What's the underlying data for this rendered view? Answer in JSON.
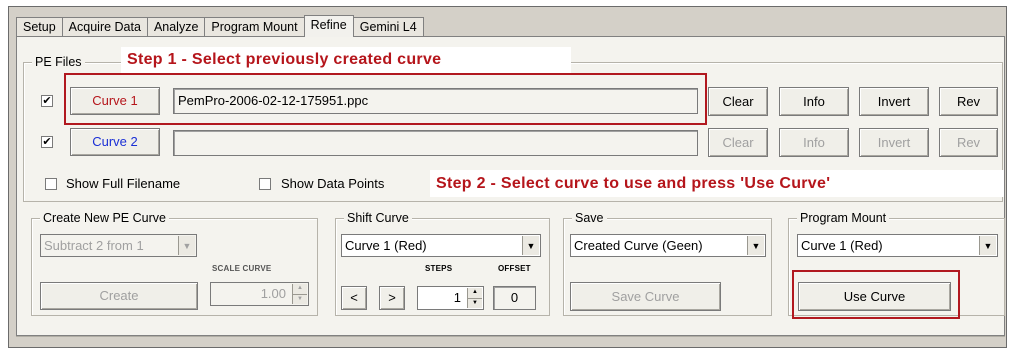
{
  "tabs": [
    "Setup",
    "Acquire Data",
    "Analyze",
    "Program Mount",
    "Refine",
    "Gemini L4"
  ],
  "pe_files": {
    "legend": "PE Files",
    "curve1": {
      "checked": "✔",
      "button": "Curve 1",
      "filename": "PemPro-2006-02-12-175951.ppc"
    },
    "curve2": {
      "checked": "✔",
      "button": "Curve 2",
      "filename": ""
    },
    "clear_label": "Clear",
    "info_label": "Info",
    "invert_label": "Invert",
    "rev_label": "Rev",
    "show_full_filename": "Show Full Filename",
    "show_data_points": "Show Data Points"
  },
  "annotations": {
    "step1": "Step 1 - Select previously created curve",
    "step2": "Step 2 - Select curve to use and press 'Use Curve'"
  },
  "create_new": {
    "legend": "Create New PE Curve",
    "select_value": "Subtract 2 from 1",
    "scale_label": "SCALE CURVE",
    "scale_value": "1.00",
    "create_label": "Create"
  },
  "shift_curve": {
    "legend": "Shift Curve",
    "select_value": "Curve 1 (Red)",
    "steps_label": "STEPS",
    "offset_label": "OFFSET",
    "steps_value": "1",
    "offset_value": "0",
    "left_label": "<",
    "right_label": ">"
  },
  "save": {
    "legend": "Save",
    "select_value": "Created Curve (Geen)",
    "save_curve_label": "Save Curve"
  },
  "program_mount": {
    "legend": "Program Mount",
    "select_value": "Curve 1 (Red)",
    "use_curve_label": "Use Curve"
  },
  "icons": {
    "dropdown": "▼",
    "up": "▲",
    "down": "▼"
  },
  "colors": {
    "annotation": "#b5151b",
    "curve1_text": "#b5151b",
    "curve2_text": "#1a2fd6"
  }
}
